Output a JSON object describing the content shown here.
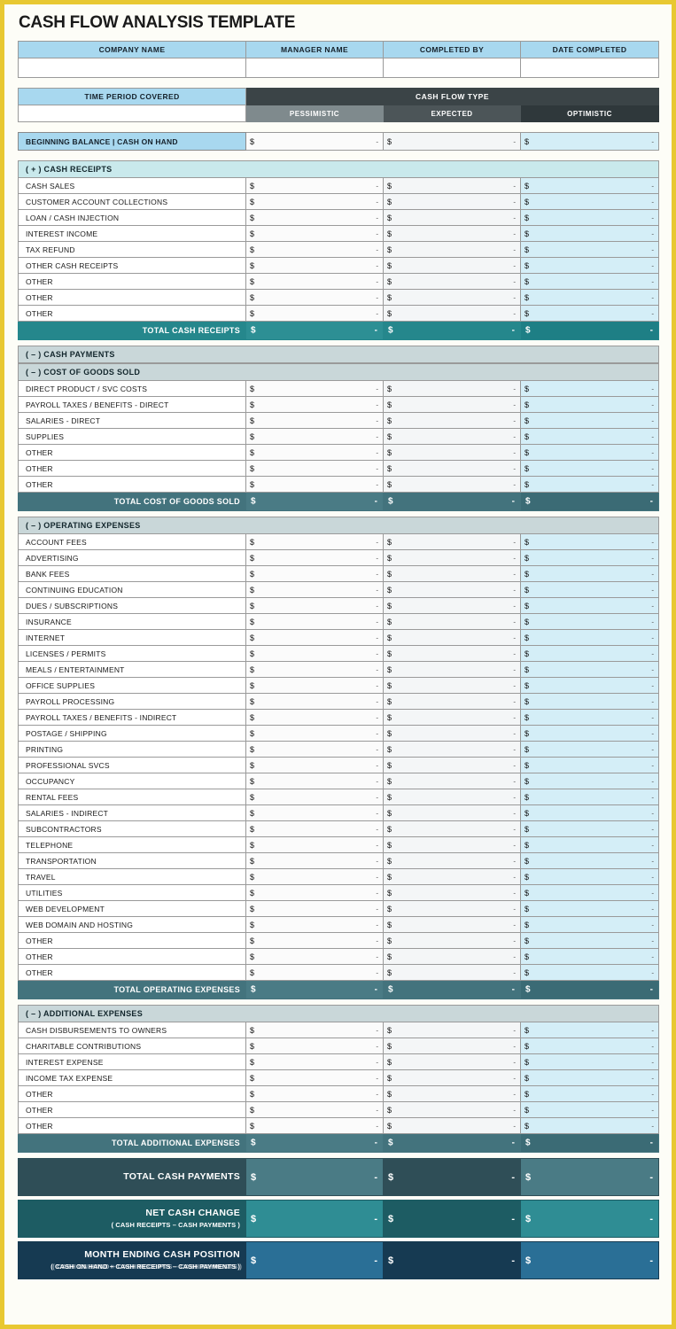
{
  "page": {
    "title": "CASH FLOW ANALYSIS TEMPLATE",
    "border_color": "#e8c832",
    "paper_color": "#fdfdf7"
  },
  "info_header": {
    "columns": [
      "COMPANY NAME",
      "MANAGER NAME",
      "COMPLETED BY",
      "DATE COMPLETED"
    ],
    "values": [
      "",
      "",
      "",
      ""
    ]
  },
  "period_header": {
    "time_period_label": "TIME PERIOD COVERED",
    "time_period_value": "",
    "cash_flow_type_label": "CASH FLOW TYPE",
    "scenarios": [
      "PESSIMISTIC",
      "EXPECTED",
      "OPTIMISTIC"
    ]
  },
  "beginning_balance": {
    "label": "BEGINNING BALANCE | CASH ON HAND",
    "currency": "$",
    "dash": "-"
  },
  "symbols": {
    "currency": "$",
    "dash": "-"
  },
  "sections": [
    {
      "id": "cash-receipts",
      "header": "( + )  CASH RECEIPTS",
      "header_style": "receipts",
      "rows": [
        "CASH SALES",
        "CUSTOMER ACCOUNT COLLECTIONS",
        "LOAN / CASH INJECTION",
        "INTEREST INCOME",
        "TAX REFUND",
        "OTHER CASH RECEIPTS",
        "OTHER",
        "OTHER",
        "OTHER"
      ],
      "total_label": "TOTAL CASH RECEIPTS",
      "total_style": "teal"
    },
    {
      "id": "cash-payments",
      "header": "( – )  CASH PAYMENTS",
      "header_style": "gray",
      "rows": [],
      "total_label": null,
      "total_style": null
    },
    {
      "id": "cost-of-goods-sold",
      "header": "( – )  COST OF GOODS SOLD",
      "header_style": "gray",
      "rows": [
        "DIRECT PRODUCT / SVC COSTS",
        "PAYROLL TAXES / BENEFITS - DIRECT",
        "SALARIES - DIRECT",
        "SUPPLIES",
        "OTHER",
        "OTHER",
        "OTHER"
      ],
      "total_label": "TOTAL COST OF GOODS SOLD",
      "total_style": "slate"
    },
    {
      "id": "operating-expenses",
      "header": "( – )  OPERATING EXPENSES",
      "header_style": "gray",
      "rows": [
        "ACCOUNT FEES",
        "ADVERTISING",
        "BANK FEES",
        "CONTINUING EDUCATION",
        "DUES / SUBSCRIPTIONS",
        "INSURANCE",
        "INTERNET",
        "LICENSES / PERMITS",
        "MEALS / ENTERTAINMENT",
        "OFFICE SUPPLIES",
        "PAYROLL PROCESSING",
        "PAYROLL TAXES / BENEFITS - INDIRECT",
        "POSTAGE / SHIPPING",
        "PRINTING",
        "PROFESSIONAL SVCS",
        "OCCUPANCY",
        "RENTAL FEES",
        "SALARIES - INDIRECT",
        "SUBCONTRACTORS",
        "TELEPHONE",
        "TRANSPORTATION",
        "TRAVEL",
        "UTILITIES",
        "WEB DEVELOPMENT",
        "WEB DOMAIN AND HOSTING",
        "OTHER",
        "OTHER",
        "OTHER"
      ],
      "total_label": "TOTAL OPERATING EXPENSES",
      "total_style": "slate"
    },
    {
      "id": "additional-expenses",
      "header": "( – )  ADDITIONAL EXPENSES",
      "header_style": "gray",
      "rows": [
        "CASH DISBURSEMENTS TO OWNERS",
        "CHARITABLE CONTRIBUTIONS",
        "INTEREST EXPENSE",
        "INCOME TAX EXPENSE",
        "OTHER",
        "OTHER",
        "OTHER"
      ],
      "total_label": "TOTAL ADDITIONAL EXPENSES",
      "total_style": "slate"
    }
  ],
  "summary_rows": [
    {
      "id": "total-cash-payments",
      "main": "TOTAL CASH PAYMENTS",
      "sub": "",
      "style": "dark"
    },
    {
      "id": "net-cash-change",
      "main": "NET CASH CHANGE",
      "sub": "( CASH RECEIPTS – CASH PAYMENTS )",
      "style": "net"
    },
    {
      "id": "month-ending-cash-position",
      "main": "MONTH ENDING CASH POSITION",
      "sub": "( CASH ON HAND + CASH RECEIPTS – CASH PAYMENTS )",
      "style": "month"
    }
  ],
  "colors": {
    "accent_yellow": "#e8c832",
    "light_blue": "#a8d8ef",
    "light_cyan": "#c9e9ec",
    "gray_blue": "#c9d7d9",
    "teal_total": "#25878c",
    "slate_total": "#43737d",
    "dark_navy": "#163a52"
  }
}
